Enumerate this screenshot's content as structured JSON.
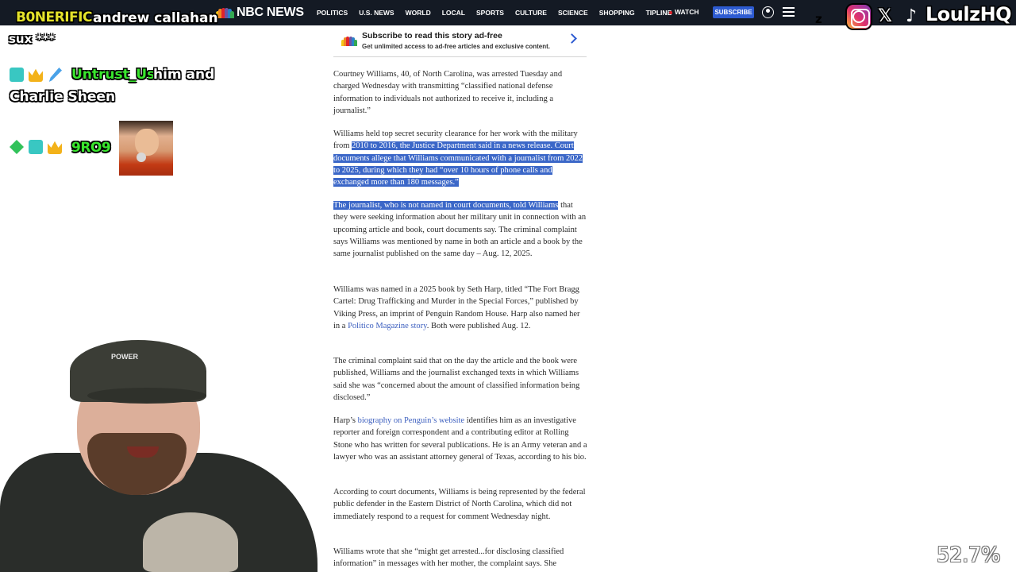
{
  "navbar": {
    "logo": "NBC NEWS",
    "items": [
      "POLITICS",
      "U.S. NEWS",
      "WORLD",
      "LOCAL",
      "SPORTS",
      "CULTURE",
      "SCIENCE",
      "SHOPPING",
      "TIPLINE"
    ],
    "watch": "WATCH",
    "subscribe": "SUBSCRIBE",
    "icons": {
      "account": "account-icon",
      "menu": "menu-icon"
    },
    "peacock_colors": [
      "#f5c518",
      "#ef8a22",
      "#e0242b",
      "#6e53a3",
      "#2a82c8",
      "#33a852"
    ]
  },
  "chat": {
    "message1": {
      "user": "B0NERIFIC",
      "text_line1": "andrew callahan",
      "text_line2": "sux ***"
    },
    "message2": {
      "badges": [
        "sub-badge-icon",
        "crown-badge-icon",
        "sword-badge-icon"
      ],
      "user": "Untrust_Us",
      "text_line1": "him and",
      "text_line2": "Charlie Sheen"
    },
    "message3": {
      "badges": [
        "gem-badge-icon",
        "sub-badge-icon",
        "crown-badge-icon"
      ],
      "user": "9RO9",
      "emote": "face-emote"
    }
  },
  "promo": {
    "title": "Subscribe to read this story ad-free",
    "subtitle": "Get unlimited access to ad-free articles and exclusive content."
  },
  "article": {
    "p1": "Courtney Williams, 40, of North Carolina, was arrested Tuesday and charged Wednesday with transmitting “classified national defense information to individuals not authorized to receive it, including a journalist.”",
    "p2_plain": "Williams held top secret security clearance for her work with the military from ",
    "p2_highlight": "2010 to 2016, the Justice Department said in a news release. Court documents allege that Williams communicated with a journalist from 2022 to 2025, during which they had “over 10 hours of phone calls and exchanged more than 180 messages.”",
    "p3_highlight": "The journalist, who is not named in court documents, told Williams",
    "p3_plain": " that they were seeking information about her military unit in connection with an upcoming article and book, court documents say. The criminal complaint says Williams was mentioned by name in both an article and a book by the same journalist published on the same day – Aug. 12, 2025.",
    "p4_a": "Williams was named in a 2025 book by Seth Harp, titled “The Fort Bragg Cartel: Drug Trafficking and Murder in the Special Forces,” published by Viking Press, an imprint of Penguin Random House. Harp also named her in a ",
    "p4_link": "Politico Magazine story",
    "p4_b": ". Both were published Aug. 12.",
    "p5": "The criminal complaint said that on the day the article and the book were published, Williams and the journalist exchanged texts in which Williams said she was “concerned about the amount of classified information being disclosed.”",
    "p6_a": "Harp’s ",
    "p6_link": "biography on Penguin’s website",
    "p6_b": " identifies him as an investigative reporter and foreign correspondent and a contributing editor at Rolling Stone who has written for several publications. He is an Army veteran and a lawyer who was an assistant attorney general of Texas, according to his bio.",
    "p7": "According to court documents, Williams is being represented by the federal public defender in the Eastern District of North Carolina, which did not immediately respond to a request for comment Wednesday night.",
    "p8": "Williams wrote that she “might get arrested...for disclosing classified information” in messages with her mother, the complaint says. She"
  },
  "overlay": {
    "z_label": "z",
    "social_icons": [
      "instagram-icon",
      "x-icon",
      "tiktok-icon"
    ],
    "x_glyph": "𝕏",
    "tiktok_glyph": "♪",
    "handle": "LoulzHQ",
    "webcam_cap_logo": "POWER",
    "progress": "52.7%"
  }
}
